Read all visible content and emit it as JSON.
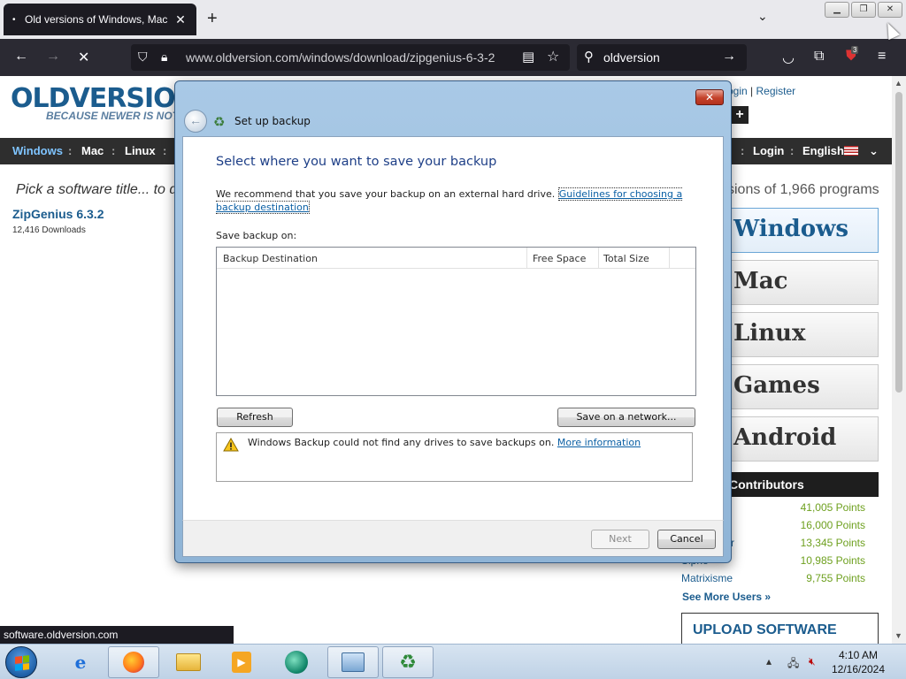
{
  "browser": {
    "tab_title": "Old versions of Windows, Mac",
    "tab_favicon": "•",
    "tab_close": "✕",
    "new_tab": "+",
    "tab_list": "⌄",
    "url": "www.oldversion.com/windows/download/zipgenius-6-3-2",
    "search_query": "oldversion",
    "status_url": "software.oldversion.com",
    "extension_badge": "3"
  },
  "site": {
    "logo": "OLDVERSION",
    "tagline": "BECAUSE NEWER IS NOT AL",
    "login": "ogin",
    "register": "Register",
    "nav": {
      "windows": "Windows",
      "mac": "Mac",
      "linux": "Linux",
      "login": "Login",
      "english": "English"
    },
    "pick_prompt": "Pick a software title... to d",
    "product_name": "ZipGenius 6.3.2",
    "product_downloads": "12,416 Downloads",
    "versions_text": "sions of 1,966 programs",
    "platforms": [
      "Windows",
      "Mac",
      "Linux",
      "Games",
      "Android"
    ],
    "contributors_title": "Contributors",
    "contributors": [
      {
        "name": "",
        "points": "41,005 Points"
      },
      {
        "name": "",
        "points": "16,000 Points"
      },
      {
        "name": "r",
        "points": "13,345 Points"
      },
      {
        "name": "Siphe",
        "points": "10,985 Points"
      },
      {
        "name": "Matrixisme",
        "points": "9,755 Points"
      }
    ],
    "see_more": "See More Users »",
    "upload": "UPLOAD SOFTWARE"
  },
  "dialog": {
    "title": "Set up backup",
    "close": "✕",
    "heading": "Select where you want to save your backup",
    "intro": "We recommend that you save your backup on an external hard drive.",
    "intro_link": "Guidelines for choosing a backup destination",
    "save_label": "Save backup on:",
    "columns": [
      "Backup Destination",
      "Free Space",
      "Total Size"
    ],
    "refresh": "Refresh",
    "save_network": "Save on a network...",
    "warning": "Windows Backup could not find any drives to save backups on.",
    "warning_link": "More information",
    "next": "Next",
    "cancel": "Cancel"
  },
  "taskbar": {
    "time": "4:10 AM",
    "date": "12/16/2024"
  },
  "colors": {
    "accent": "#1b5c8e",
    "dialog_heading": "#1e3f87",
    "points": "#6ea01f"
  }
}
